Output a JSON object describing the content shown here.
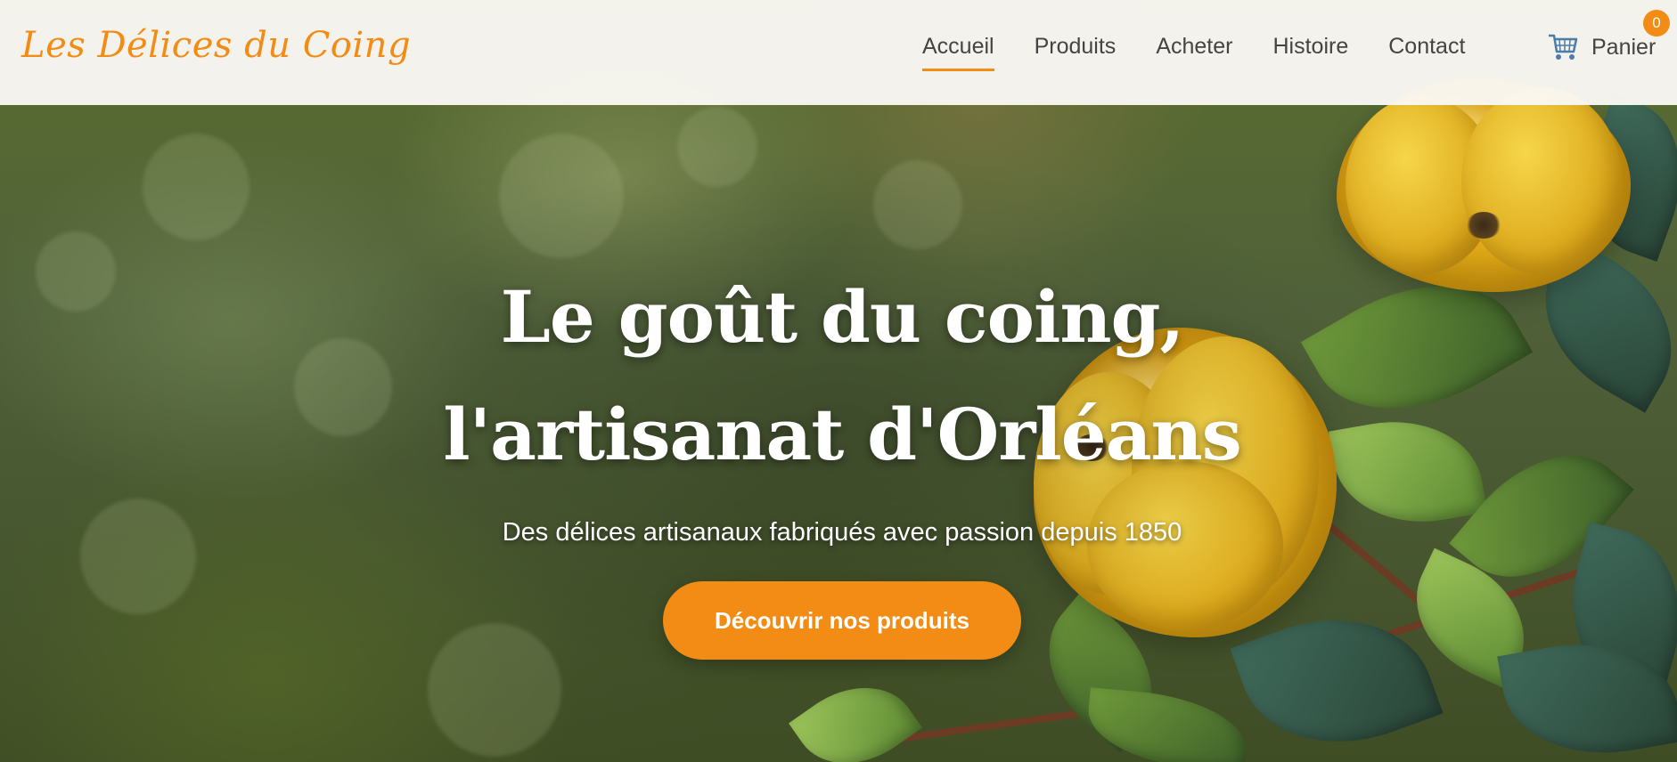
{
  "brand": {
    "name": "Les Délices du Coing",
    "accent_color": "#f28c14"
  },
  "nav": {
    "items": [
      {
        "label": "Accueil",
        "active": true
      },
      {
        "label": "Produits",
        "active": false
      },
      {
        "label": "Acheter",
        "active": false
      },
      {
        "label": "Histoire",
        "active": false
      },
      {
        "label": "Contact",
        "active": false
      }
    ]
  },
  "cart": {
    "label": "Panier",
    "count": "0",
    "icon": "shopping-cart-icon"
  },
  "hero": {
    "title": "Le goût du coing, l'artisanat d'Orléans",
    "subtitle": "Des délices artisanaux fabriqués avec passion depuis 1850",
    "cta_label": "Découvrir nos produits",
    "background_image": "quince-branch-photo"
  }
}
